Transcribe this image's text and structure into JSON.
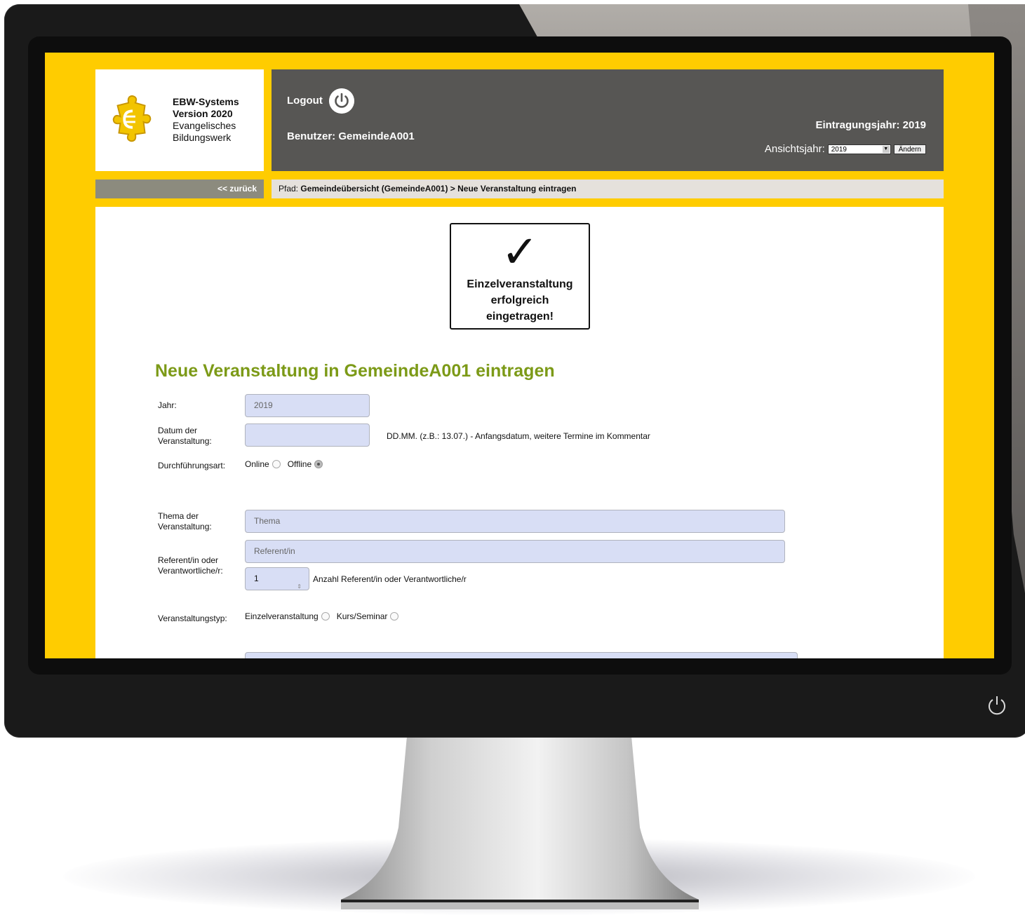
{
  "logo": {
    "line1": "EBW-Systems",
    "line2": "Version 2020",
    "line3": "Evangelisches",
    "line4": "Bildungswerk"
  },
  "header": {
    "logout_label": "Logout",
    "user_label": "Benutzer: GemeindeA001",
    "entry_year_label": "Eintragungsjahr: 2019",
    "view_year_label": "Ansichtsjahr:",
    "view_year_value": "2019",
    "change_button": "Ändern"
  },
  "nav": {
    "back_label": "<< zurück",
    "path_prefix": "Pfad:",
    "path_value": "Gemeindeübersicht (GemeindeA001) > Neue Veranstaltung eintragen"
  },
  "success": {
    "check": "✓",
    "line1": "Einzelveranstaltung",
    "line2": "erfolgreich",
    "line3": "eingetragen!"
  },
  "form": {
    "title": "Neue Veranstaltung in GemeindeA001 eintragen",
    "jahr_label": "Jahr:",
    "jahr_value": "2019",
    "datum_label_1": "Datum der",
    "datum_label_2": "Veranstaltung:",
    "datum_hint": "DD.MM. (z.B.: 13.07.) - Anfangsdatum, weitere Termine im Kommentar",
    "art_label": "Durchführungsart:",
    "art_online": "Online",
    "art_offline": "Offline",
    "thema_label_1": "Thema der",
    "thema_label_2": "Veranstaltung:",
    "thema_placeholder": "Thema",
    "referent_label_1": "Referent/in oder",
    "referent_label_2": "Verantwortliche/r:",
    "referent_placeholder": "Referent/in",
    "anzahl_value": "1",
    "anzahl_hint": "Anzahl Referent/in oder Verantwortliche/r",
    "typ_label": "Veranstaltungstyp:",
    "typ_einzel": "Einzelveranstaltung",
    "typ_kurs": "Kurs/Seminar"
  },
  "colors": {
    "brand_yellow": "#ffcc00",
    "header_gray": "#575654",
    "title_green": "#7c9a17",
    "input_bg": "#d8def5"
  }
}
